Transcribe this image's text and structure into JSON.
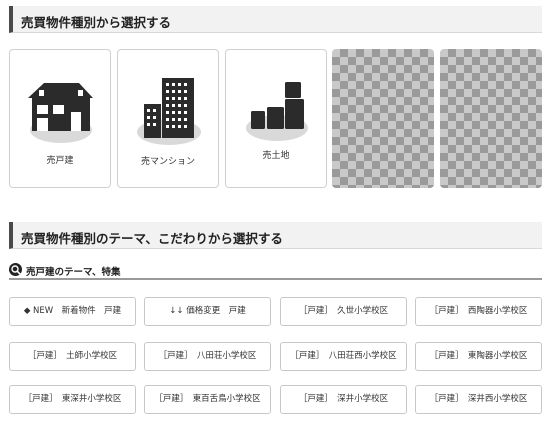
{
  "section1": {
    "title": "売買物件種別から選択する"
  },
  "types": [
    {
      "label": "売戸建"
    },
    {
      "label": "売マンション"
    },
    {
      "label": "売土地"
    }
  ],
  "section2": {
    "title": "売買物件種別のテーマ、こだわりから選択する"
  },
  "subsection": {
    "title": "売戸建のテーマ、特集"
  },
  "themes": [
    {
      "label": "◆ NEW　新着物件　戸建"
    },
    {
      "label": "↓↓ 価格変更　戸建"
    },
    {
      "label": "［戸建］　久世小学校区"
    },
    {
      "label": "［戸建］　西陶器小学校区"
    },
    {
      "label": "［戸建］　土師小学校区"
    },
    {
      "label": "［戸建］　八田荘小学校区"
    },
    {
      "label": "［戸建］　八田荘西小学校区"
    },
    {
      "label": "［戸建］　東陶器小学校区"
    },
    {
      "label": "［戸建］　東深井小学校区"
    },
    {
      "label": "［戸建］　東百舌鳥小学校区"
    },
    {
      "label": "［戸建］　深井小学校区"
    },
    {
      "label": "［戸建］　深井西小学校区"
    }
  ],
  "icons": {
    "house": "house-icon",
    "mansion": "apartment-building-icon",
    "land": "land-plot-icon",
    "search": "search-icon"
  },
  "colors": {
    "icon_dark": "#2b2b2b",
    "icon_shadow": "#d9d9d9",
    "accent_bar": "#4a4a4a"
  }
}
